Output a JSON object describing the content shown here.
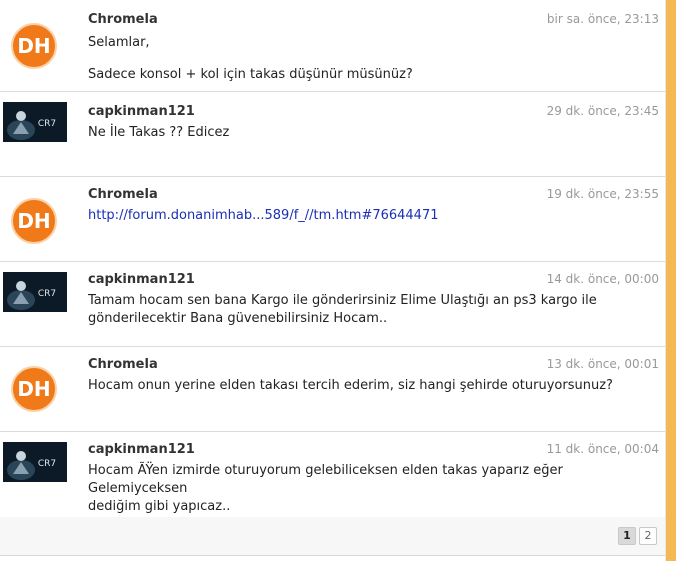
{
  "posts": [
    {
      "author": "Chromela",
      "time": "bir sa. önce, 23:13",
      "lines": [
        "Selamlar,",
        "Sadece konsol + kol için takas düşünür müsünüz?"
      ]
    },
    {
      "author": "capkinman121",
      "time": "29 dk. önce, 23:45",
      "lines": [
        "Ne İle Takas ?? Edicez"
      ]
    },
    {
      "author": "Chromela",
      "time": "19 dk. önce, 23:55",
      "link": "http://forum.donanimhab...589/f_//tm.htm#76644471"
    },
    {
      "author": "capkinman121",
      "time": "14 dk. önce, 00:00",
      "lines": [
        "Tamam hocam sen bana Kargo ile gönderirsiniz Elime Ulaştığı an ps3 kargo ile",
        "gönderilecektir Bana güvenebilirsiniz Hocam.."
      ]
    },
    {
      "author": "Chromela",
      "time": "13 dk. önce, 00:01",
      "lines": [
        "Hocam onun yerine elden takası tercih ederim, siz hangi şehirde oturuyorsunuz?"
      ]
    },
    {
      "author": "capkinman121",
      "time": "11 dk. önce, 00:04",
      "lines": [
        "Hocam ÃŸen izmirde oturuyorum gelebiliceksen elden takas yaparız eğer Gelemiyceksen",
        "dediğim gibi yapıcaz.."
      ]
    }
  ],
  "avatars": {
    "logo_text": "DH",
    "photo_text": "CR7",
    "logo_color": "#f07a1a"
  },
  "pagination": {
    "pages": [
      "1",
      "2"
    ],
    "current": "1"
  }
}
